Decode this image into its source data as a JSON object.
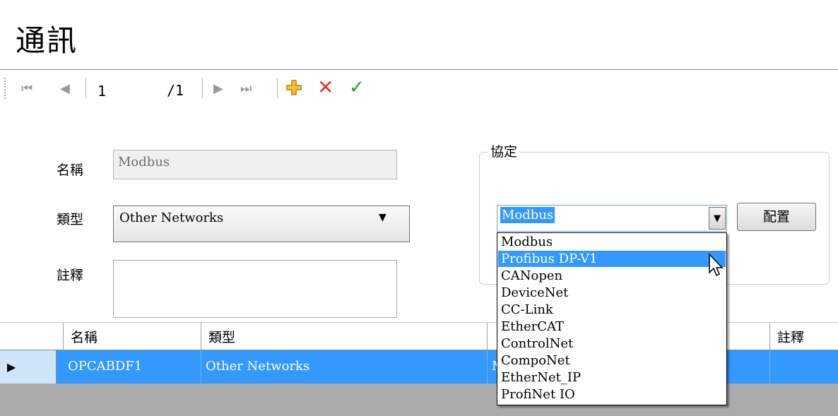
{
  "page": {
    "title": "通訊"
  },
  "toolbar": {
    "first_icon": "⏮",
    "prev_icon": "◀",
    "position": "1",
    "total": "/1",
    "next_icon": "▶",
    "last_icon": "⏭",
    "add_icon": "plus-icon",
    "delete_icon": "✕",
    "accept_icon": "✓"
  },
  "form": {
    "name_label": "名稱",
    "name_value": "Modbus",
    "type_label": "類型",
    "type_value": "Other Networks",
    "note_label": "註釋",
    "note_value": ""
  },
  "protocol": {
    "group_label": "協定",
    "selected": "Modbus",
    "config_label": "配置",
    "options": [
      "Modbus",
      "Profibus DP-V1",
      "CANopen",
      "DeviceNet",
      "CC-Link",
      "EtherCAT",
      "ControlNet",
      "CompoNet",
      "EtherNet_IP",
      "ProfiNet IO"
    ],
    "highlighted_option": "Profibus DP-V1"
  },
  "grid": {
    "columns": [
      "名稱",
      "類型",
      "註釋"
    ],
    "rows": [
      {
        "name": "OPCABDF1",
        "type": "Other Networks",
        "protocol_partial": "M",
        "note": ""
      }
    ]
  },
  "colors": {
    "selection": "#3399ff",
    "delete": "#e03a2a",
    "accept": "#2c9a2c",
    "add": "#f0b400"
  }
}
